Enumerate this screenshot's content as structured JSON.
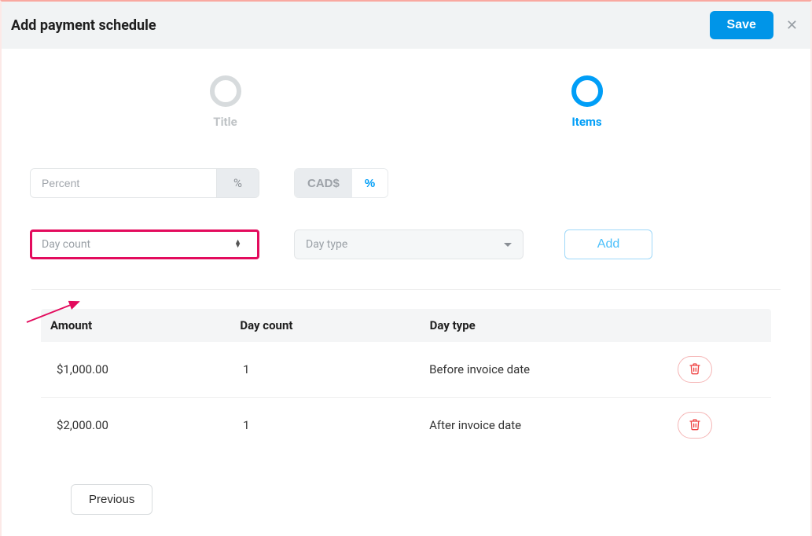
{
  "header": {
    "title": "Add payment schedule",
    "save_label": "Save"
  },
  "stepper": {
    "title_label": "Title",
    "items_label": "Items"
  },
  "controls": {
    "percent_placeholder": "Percent",
    "percent_symbol": "%",
    "currency_label": "CAD$",
    "currency_percent_label": "%",
    "daycount_placeholder": "Day count",
    "daytype_placeholder": "Day type",
    "add_label": "Add"
  },
  "table": {
    "headers": {
      "amount": "Amount",
      "day_count": "Day count",
      "day_type": "Day type"
    },
    "rows": [
      {
        "amount": "$1,000.00",
        "day_count": "1",
        "day_type": "Before invoice date"
      },
      {
        "amount": "$2,000.00",
        "day_count": "1",
        "day_type": "After invoice date"
      }
    ]
  },
  "footer": {
    "previous_label": "Previous"
  }
}
